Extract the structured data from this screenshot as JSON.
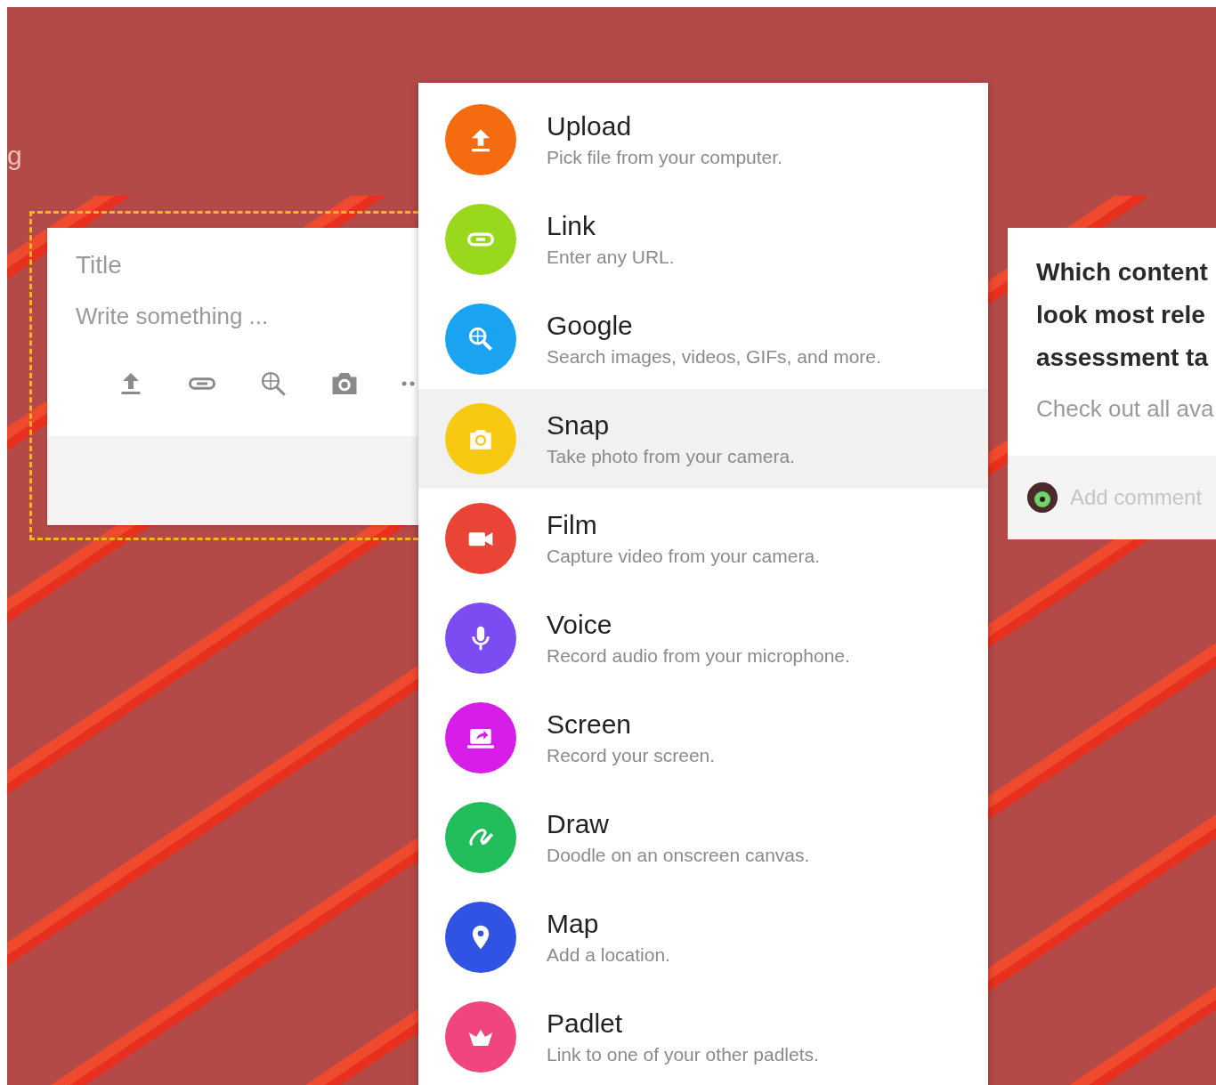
{
  "board_title_fragment": "g",
  "draft_post": {
    "title_placeholder": "Title",
    "body_placeholder": "Write something ..."
  },
  "attachment_menu": {
    "items": [
      {
        "kind": "upload",
        "title": "Upload",
        "description": "Pick file from your computer.",
        "color": "#f46c0f",
        "selected": false
      },
      {
        "kind": "link",
        "title": "Link",
        "description": "Enter any URL.",
        "color": "#9ad81e",
        "selected": false
      },
      {
        "kind": "search",
        "title": "Google",
        "description": "Search images, videos, GIFs, and more.",
        "color": "#1aa3f0",
        "selected": false
      },
      {
        "kind": "camera",
        "title": "Snap",
        "description": "Take photo from your camera.",
        "color": "#f8c912",
        "selected": true
      },
      {
        "kind": "video",
        "title": "Film",
        "description": "Capture video from your camera.",
        "color": "#ea4436",
        "selected": false
      },
      {
        "kind": "mic",
        "title": "Voice",
        "description": "Record audio from your microphone.",
        "color": "#7a4cf2",
        "selected": false
      },
      {
        "kind": "screen",
        "title": "Screen",
        "description": "Record your screen.",
        "color": "#d61ee8",
        "selected": false
      },
      {
        "kind": "draw",
        "title": "Draw",
        "description": "Doodle on an onscreen canvas.",
        "color": "#20bd5a",
        "selected": false
      },
      {
        "kind": "map",
        "title": "Map",
        "description": "Add a location.",
        "color": "#3153e4",
        "selected": false
      },
      {
        "kind": "padlet",
        "title": "Padlet",
        "description": "Link to one of your other padlets.",
        "color": "#f0457f",
        "selected": false
      }
    ]
  },
  "post": {
    "title_lines": [
      "Which content",
      "look most rele",
      "assessment ta"
    ],
    "body": "Check out all ava",
    "comment_placeholder": "Add comment"
  }
}
